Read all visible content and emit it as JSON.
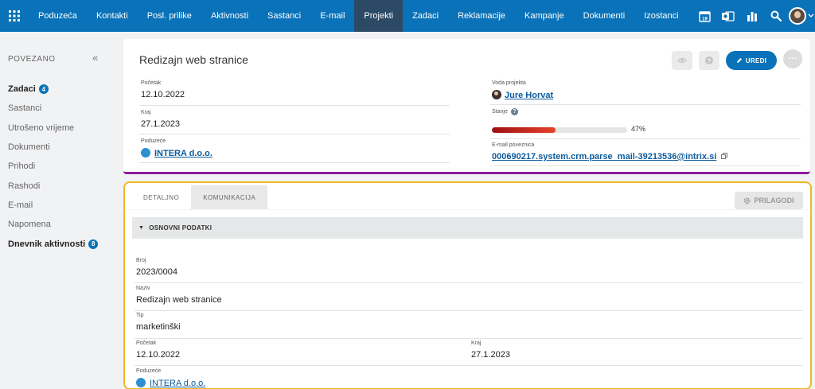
{
  "nav": {
    "items": [
      "Poduzeća",
      "Kontakti",
      "Posl. prilike",
      "Aktivnosti",
      "Sastanci",
      "E-mail",
      "Projekti",
      "Zadaci",
      "Reklamacije",
      "Kampanje",
      "Dokumenti",
      "Izostanci"
    ],
    "active_index": 6,
    "calendar_day": "19",
    "colors": {
      "bar": "#0a72b8",
      "active": "#2c4a66"
    }
  },
  "sidebar": {
    "heading": "POVEZANO",
    "collapse_glyph": "«",
    "items": [
      {
        "label": "Zadaci",
        "badge": "4"
      },
      {
        "label": "Sastanci"
      },
      {
        "label": "Utrošeno vrijeme"
      },
      {
        "label": "Dokumenti"
      },
      {
        "label": "Prihodi"
      },
      {
        "label": "Rashodi"
      },
      {
        "label": "E-mail"
      },
      {
        "label": "Napomena"
      },
      {
        "label": "Dnevnik aktivnosti",
        "badge": "8"
      }
    ]
  },
  "project": {
    "title": "Redizajn web stranice",
    "edit_label": "UREDI",
    "more_label": "···",
    "start_label": "Početak",
    "start_value": "12.10.2022",
    "end_label": "Kraj",
    "end_value": "27.1.2023",
    "company_label": "Poduzeće",
    "company_value": "INTERA d.o.o.",
    "lead_label": "Voda projekta",
    "lead_value": "Jure Horvat",
    "status_label": "Stanje",
    "progress_percent": 47,
    "progress_text": "47%",
    "email_label": "E-mail poveznica",
    "email_value": "000690217.system.crm.parse_mail-39213536@intrix.si"
  },
  "details": {
    "tabs": [
      "DETALJNO",
      "KOMUNIKACIJA"
    ],
    "customize_label": "PRILAGODI",
    "section_title": "OSNOVNI PODATKI",
    "broj_label": "Broj",
    "broj_value": "2023/0004",
    "naziv_label": "Naziv",
    "naziv_value": "Redizajn web stranice",
    "tip_label": "Tip",
    "tip_value": "marketinški",
    "start_label": "Početak",
    "start_value": "12.10.2022",
    "end_label": "Kraj",
    "end_value": "27.1.2023",
    "company_label": "Poduzeće",
    "company_value": "INTERA d.o.o."
  }
}
